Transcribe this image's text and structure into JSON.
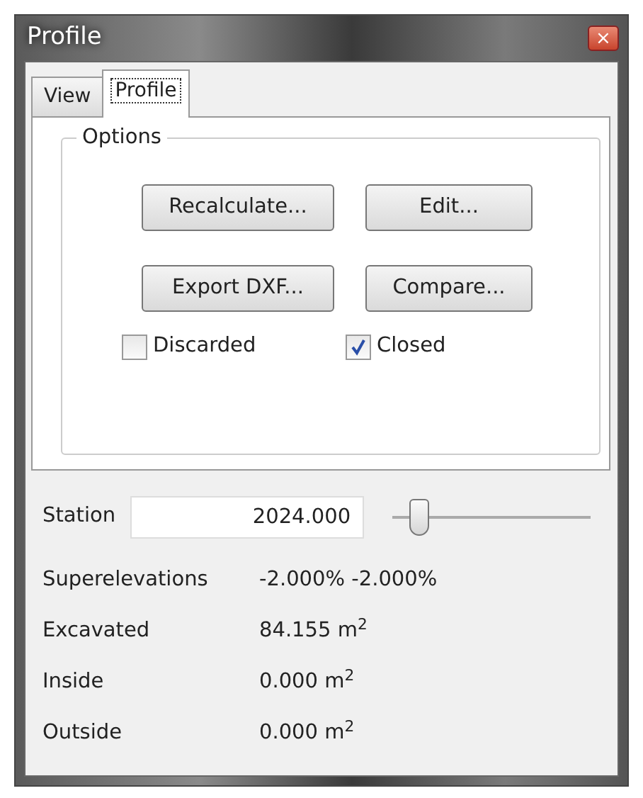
{
  "window": {
    "title": "Profile",
    "close": "×"
  },
  "tabs": [
    {
      "label": "View",
      "selected": false
    },
    {
      "label": "Profile",
      "selected": true
    }
  ],
  "options": {
    "title": "Options",
    "buttons": [
      "Recalculate...",
      "Edit...",
      "Export DXF...",
      "Compare..."
    ],
    "checkboxes": [
      {
        "label": "Discarded",
        "checked": false
      },
      {
        "label": "Closed",
        "checked": true
      }
    ]
  },
  "station": {
    "label": "Station",
    "value": "2024.000",
    "level": 0.1
  },
  "readouts": [
    {
      "label": "Superelevations",
      "value": "-2.000% -2.000%"
    },
    {
      "label": "Excavated",
      "value": "84.155 m$^{2}$"
    },
    {
      "label": "Inside",
      "value": "0.000 m$^{2}$"
    },
    {
      "label": "Outside",
      "value": "0.000 m$^{2}$"
    }
  ]
}
